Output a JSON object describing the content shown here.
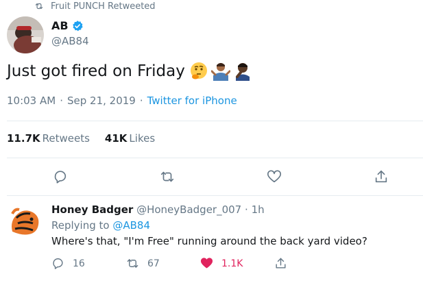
{
  "retweet_banner": {
    "text": "Fruit PUNCH Retweeted",
    "icon": "retweet-icon"
  },
  "tweet": {
    "author_name": "AB",
    "author_handle": "@AB84",
    "verified": true,
    "text": "Just got fired on Friday",
    "emojis": [
      "thinking-face-emoji",
      "person-shrugging-emoji",
      "person-facepalming-emoji"
    ],
    "time": "10:03 AM",
    "date": "Sep 21, 2019",
    "source": "Twitter for iPhone",
    "retweets_count": "11.7K",
    "retweets_label": "Retweets",
    "likes_count": "41K",
    "likes_label": "Likes"
  },
  "actions": [
    "reply-icon",
    "retweet-icon",
    "like-icon",
    "share-icon"
  ],
  "reply": {
    "name": "Honey Badger",
    "handle": "@HoneyBadger_007",
    "time": "1h",
    "replying_to_label": "Replying to",
    "replying_to_handle": "@AB84",
    "text": "Where's that, \"I'm Free\" running around the back yard video?",
    "reply_count": "16",
    "retweet_count": "67",
    "like_count": "1.1K"
  },
  "colors": {
    "accent": "#1b95e0",
    "muted": "#657786",
    "like": "#e0245e",
    "divider": "#e6ecf0"
  }
}
